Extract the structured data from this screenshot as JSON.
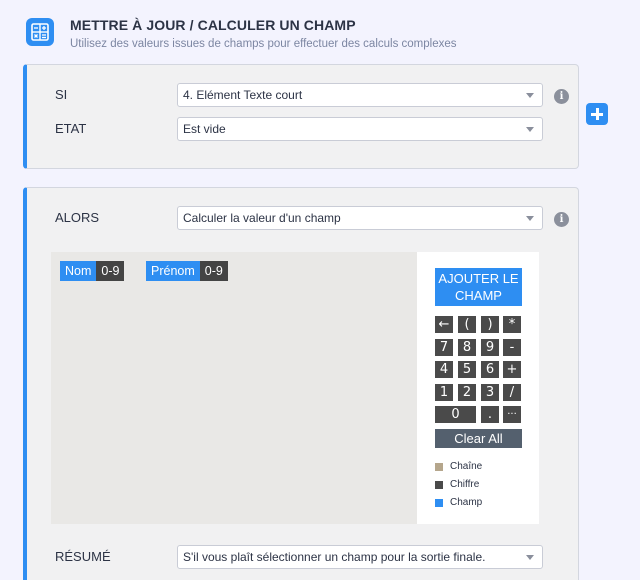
{
  "header": {
    "title": "METTRE À JOUR / CALCULER UN CHAMP",
    "subtitle": "Utilisez des valeurs issues de champs pour effectuer des calculs complexes"
  },
  "condition": {
    "if_label": "SI",
    "if_value": "4. Elément Texte court",
    "state_label": "ETAT",
    "state_value": "Est vide"
  },
  "action": {
    "then_label": "ALORS",
    "then_value": "Calculer la valeur d'un champ",
    "summary_label": "RÉSUMÉ",
    "summary_value": "S'il vous plaît sélectionner un champ pour la sortie finale."
  },
  "info_glyph": "i",
  "editor": {
    "chips": [
      {
        "name": "Nom",
        "type": "0-9"
      },
      {
        "name": "Prénom",
        "type": "0-9"
      }
    ]
  },
  "pad": {
    "add_field": "AJOUTER LE CHAMP",
    "keys": [
      "←",
      "(",
      ")",
      "*",
      "7",
      "8",
      "9",
      "-",
      "4",
      "5",
      "6",
      "+",
      "1",
      "2",
      "3",
      "/",
      "0",
      ".",
      "···"
    ],
    "clear": "Clear All"
  },
  "legend": [
    {
      "label": "Chaîne",
      "color": "#b5a68c"
    },
    {
      "label": "Chiffre",
      "color": "#4a4a4a"
    },
    {
      "label": "Champ",
      "color": "#2e8ef2"
    }
  ],
  "colors": {
    "accent": "#2e8ef2",
    "keys": "#4a4a4a",
    "clear": "#54606e"
  }
}
